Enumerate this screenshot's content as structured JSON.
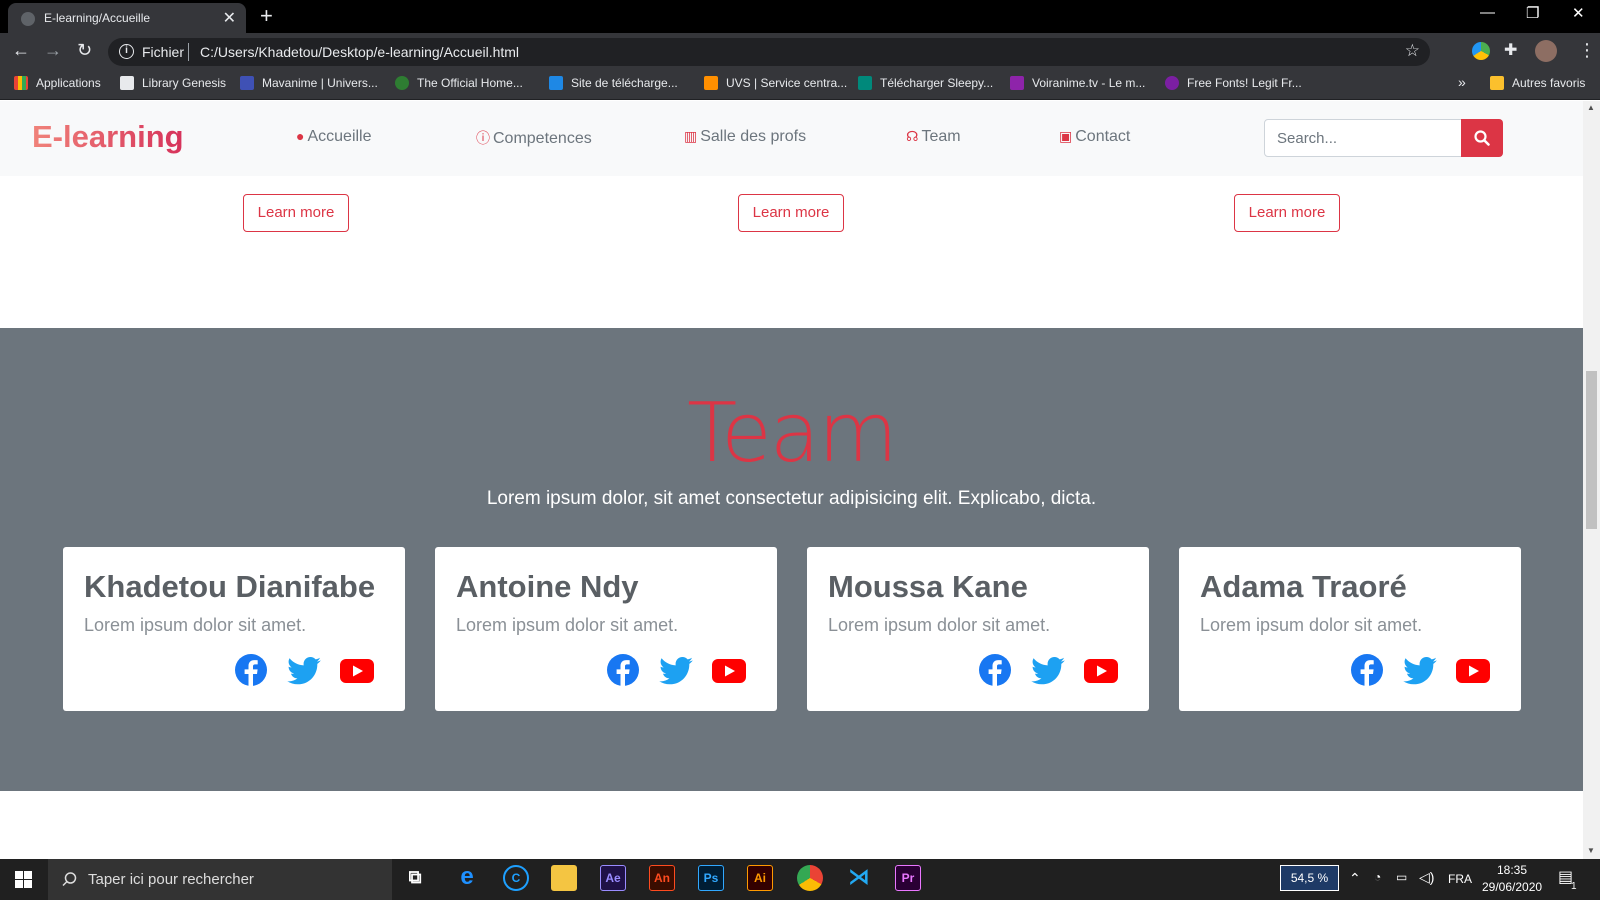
{
  "browser": {
    "tab_title": "E-learning/Accueille",
    "scheme_label": "Fichier",
    "url": "C:/Users/Khadetou/Desktop/e-learning/Accueil.html",
    "bookmarks": [
      "Applications",
      "Library Genesis",
      "Mavanime | Univers...",
      "The Official Home...",
      "Site de télécharge...",
      "UVS | Service centra...",
      "Télécharger Sleepy...",
      "Voiranime.tv - Le m...",
      "Free Fonts! Legit Fr..."
    ],
    "bookmarks_overflow": "»",
    "other_bookmarks": "Autres favoris"
  },
  "site": {
    "brand": "E-learning",
    "nav": [
      {
        "label": "Accueille",
        "icon": "chat-bubble-icon"
      },
      {
        "label": "Competences",
        "icon": "info-circle-icon"
      },
      {
        "label": "Salle des profs",
        "icon": "teacher-icon"
      },
      {
        "label": "Team",
        "icon": "headset-icon"
      },
      {
        "label": "Contact",
        "icon": "contact-card-icon"
      }
    ],
    "search": {
      "placeholder": "Search..."
    },
    "learn_more": "Learn more"
  },
  "team": {
    "title": "Team",
    "subtitle": "Lorem ipsum dolor, sit amet consectetur adipisicing elit. Explicabo, dicta.",
    "members": [
      {
        "name": "Khadetou Dianifabe",
        "desc": "Lorem ipsum dolor sit amet."
      },
      {
        "name": "Antoine Ndy",
        "desc": "Lorem ipsum dolor sit amet."
      },
      {
        "name": "Moussa Kane",
        "desc": "Lorem ipsum dolor sit amet."
      },
      {
        "name": "Adama Traoré",
        "desc": "Lorem ipsum dolor sit amet."
      }
    ]
  },
  "taskbar": {
    "search_placeholder": "Taper ici pour rechercher",
    "zoom": "54,5 %",
    "language": "FRA",
    "time": "18:35",
    "date": "29/06/2020",
    "notifications": "1"
  },
  "colors": {
    "accent": "#dc3545",
    "team_bg": "#6c757d",
    "navbar_bg": "#f8f9fa"
  }
}
